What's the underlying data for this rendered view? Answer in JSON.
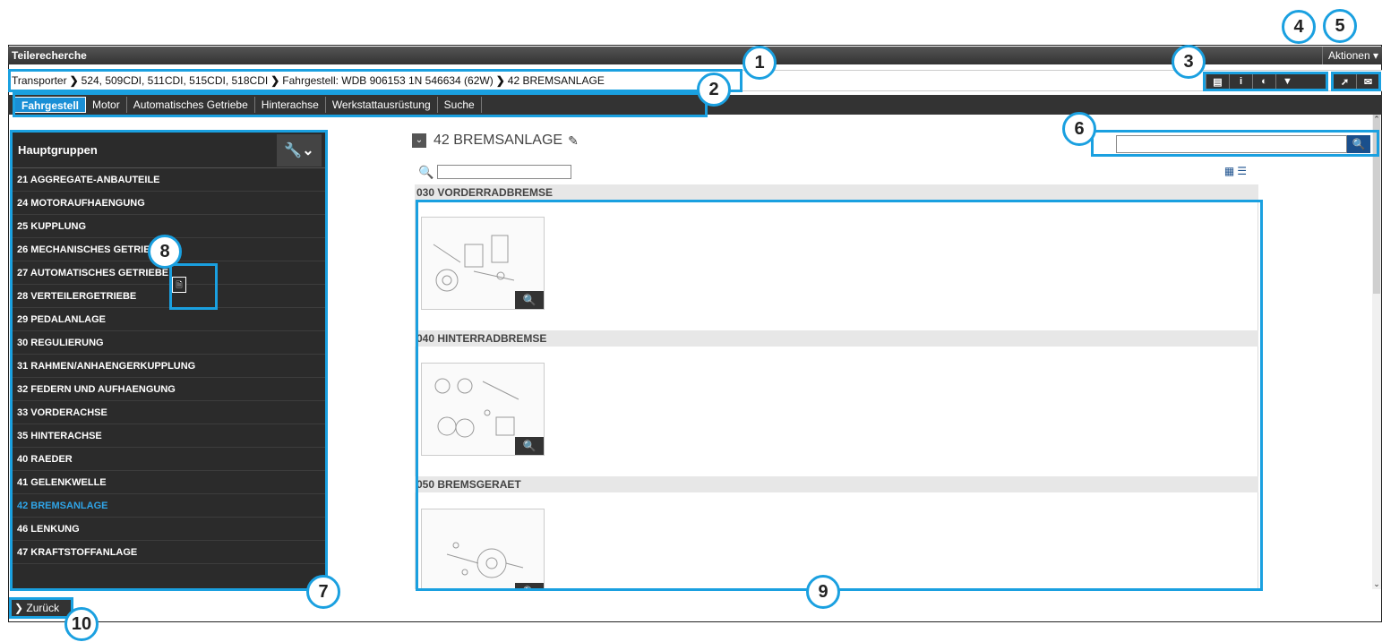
{
  "window": {
    "title": "Teilerecherche",
    "actions_label": "Aktionen ▾"
  },
  "breadcrumb": {
    "items": [
      "Transporter",
      "524, 509CDI, 511CDI, 515CDI, 518CDI",
      "Fahrgestell: WDB 906153 1N 546634 (62W)",
      "42 BREMSANLAGE"
    ],
    "separator": "❯"
  },
  "toolbar": {
    "icons": [
      "car-icon",
      "info-icon",
      "contrast-icon",
      "filter-icon"
    ],
    "glyphs": [
      "▤",
      "i",
      "◐",
      "▼"
    ],
    "extra": [
      "export-icon",
      "mail-icon"
    ],
    "extra_glyphs": [
      "➚",
      "✉"
    ]
  },
  "tabs": [
    {
      "label": "Fahrgestell",
      "active": true
    },
    {
      "label": "Motor",
      "active": false
    },
    {
      "label": "Automatisches Getriebe",
      "active": false
    },
    {
      "label": "Hinterachse",
      "active": false
    },
    {
      "label": "Werkstattausrüstung",
      "active": false
    },
    {
      "label": "Suche",
      "active": false
    }
  ],
  "sidebar": {
    "title": "Hauptgruppen",
    "items": [
      {
        "label": "21 AGGREGATE-ANBAUTEILE",
        "active": false
      },
      {
        "label": "24 MOTORAUFHAENGUNG",
        "active": false
      },
      {
        "label": "25 KUPPLUNG",
        "active": false
      },
      {
        "label": "26 MECHANISCHES GETRIEBE",
        "active": false
      },
      {
        "label": "27 AUTOMATISCHES GETRIEBE",
        "active": false
      },
      {
        "label": "28 VERTEILERGETRIEBE",
        "active": false
      },
      {
        "label": "29 PEDALANLAGE",
        "active": false
      },
      {
        "label": "30 REGULIERUNG",
        "active": false
      },
      {
        "label": "31 RAHMEN/ANHAENGERKUPPLUNG",
        "active": false
      },
      {
        "label": "32 FEDERN UND AUFHAENGUNG",
        "active": false
      },
      {
        "label": "33 VORDERACHSE",
        "active": false
      },
      {
        "label": "35 HINTERACHSE",
        "active": false
      },
      {
        "label": "40 RAEDER",
        "active": false
      },
      {
        "label": "41 GELENKWELLE",
        "active": false
      },
      {
        "label": "42 BREMSANLAGE",
        "active": true
      },
      {
        "label": "46 LENKUNG",
        "active": false
      },
      {
        "label": "47 KRAFTSTOFFANLAGE",
        "active": false
      }
    ]
  },
  "back_button": {
    "label": "❯ Zurück"
  },
  "content": {
    "title": "42 BREMSANLAGE",
    "filter_placeholder": "",
    "groups": [
      {
        "label": "030 VORDERRADBREMSE"
      },
      {
        "label": "040 HINTERRADBREMSE"
      },
      {
        "label": "050 BREMSGERAET"
      }
    ]
  },
  "search": {
    "placeholder": ""
  },
  "callouts": [
    "1",
    "2",
    "3",
    "4",
    "5",
    "6",
    "7",
    "8",
    "9",
    "10"
  ],
  "colors": {
    "accent": "#1aa0e0",
    "active_tab": "#1a8fd6",
    "sidebar_bg": "#2b2b2b",
    "active_item": "#2fa4e7"
  }
}
